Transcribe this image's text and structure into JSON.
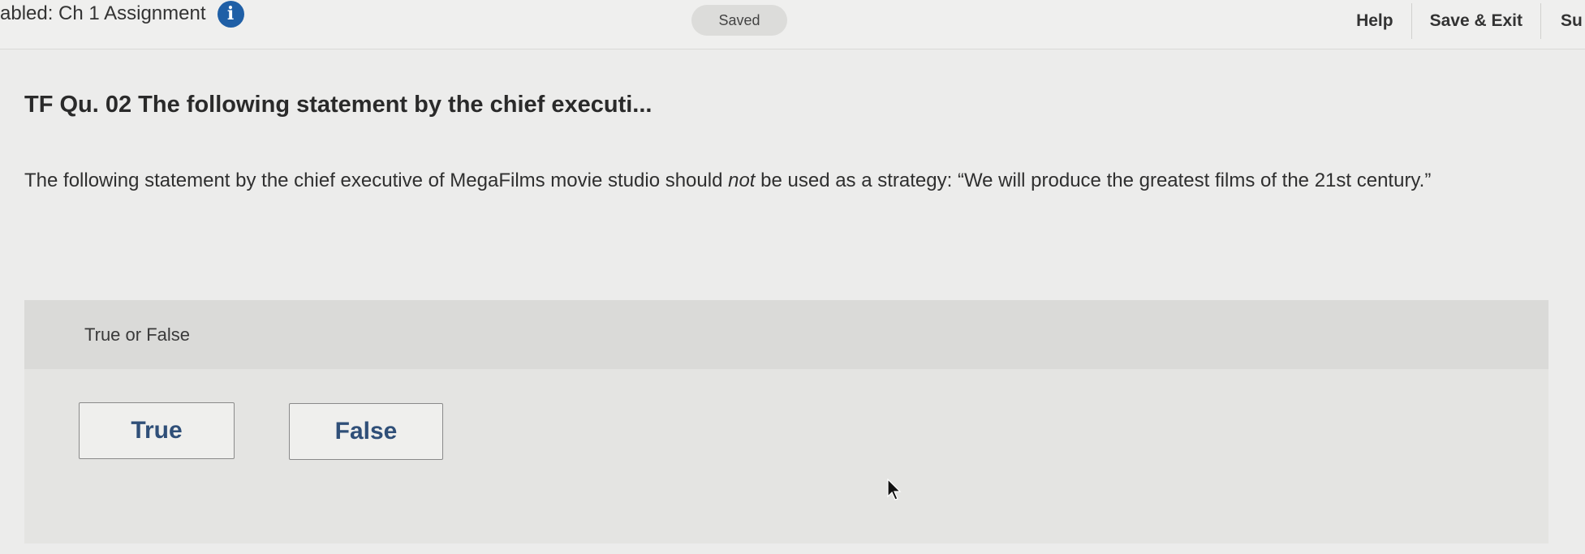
{
  "header": {
    "assignment_title": "abled: Ch 1 Assignment",
    "info_icon_glyph": "i",
    "info_icon": "info-circle-icon",
    "status": "Saved",
    "nav": {
      "help": "Help",
      "save_exit": "Save & Exit",
      "submit_partial": "Su"
    }
  },
  "question": {
    "title": "TF Qu. 02 The following statement by the chief executi...",
    "text_before": "The following statement by the chief executive of MegaFilms movie studio should ",
    "text_emphasis": "not",
    "text_after": " be used as a strategy: “We will produce the greatest films of the 21st century.”"
  },
  "answer": {
    "prompt": "True or False",
    "options": [
      "True",
      "False"
    ]
  },
  "colors": {
    "accent": "#1f5fa6",
    "button_text": "#2f4f78"
  }
}
